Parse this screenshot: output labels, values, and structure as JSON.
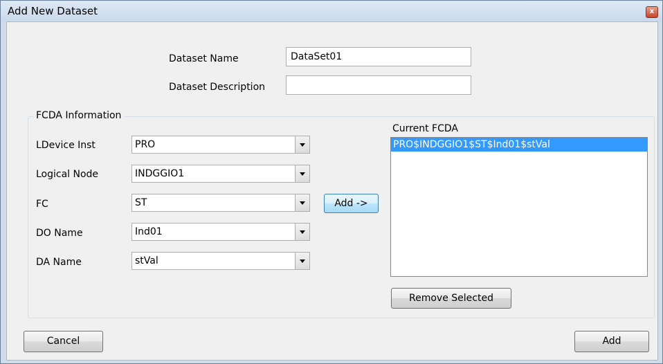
{
  "window": {
    "title": "Add New Dataset",
    "close_glyph": "x"
  },
  "dataset": {
    "name_label": "Dataset Name",
    "name_value": "DataSet01",
    "description_label": "Dataset Description",
    "description_value": ""
  },
  "fcda_group": {
    "legend": "FCDA Information",
    "ldevice_label": "LDevice Inst",
    "ldevice_value": "PRO",
    "logical_node_label": "Logical Node",
    "logical_node_value": "INDGGIO1",
    "fc_label": "FC",
    "fc_value": "ST",
    "do_name_label": "DO Name",
    "do_name_value": "Ind01",
    "da_name_label": "DA Name",
    "da_name_value": "stVal",
    "add_arrow_label": "Add ->",
    "current_label": "Current FCDA",
    "current_items": [
      "PRO$INDGGIO1$ST$Ind01$stVal"
    ],
    "remove_label": "Remove Selected"
  },
  "footer": {
    "cancel_label": "Cancel",
    "add_label": "Add"
  },
  "colors": {
    "selection": "#3399ff",
    "window_frame": "#cfdcec",
    "close_button": "#c7452b"
  },
  "icons": {
    "close": "close-icon",
    "dropdown": "chevron-down-icon"
  }
}
